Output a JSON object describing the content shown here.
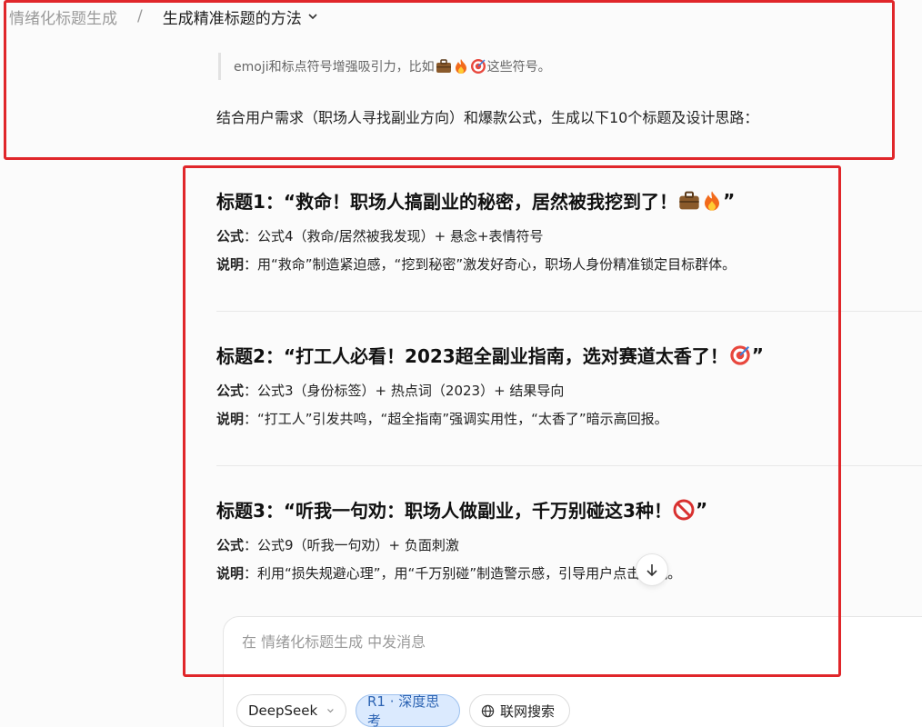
{
  "breadcrumb": {
    "root": "情绪化标题生成",
    "separator": "/",
    "current": "生成精准标题的方法"
  },
  "quote": {
    "text_before": "emoji和标点符号增强吸引力，比如",
    "emojis": [
      "briefcase-emoji",
      "fire-emoji",
      "target-emoji"
    ],
    "text_after": "这些符号。"
  },
  "intro": "结合用户需求（职场人寻找副业方向）和爆款公式，生成以下10个标题及设计思路：",
  "titles": [
    {
      "heading": "标题1：“救命！职场人搞副业的秘密，居然被我挖到了！",
      "emojis": [
        "briefcase-emoji",
        "fire-emoji"
      ],
      "heading_end": "”",
      "formula_label": "公式",
      "formula": "：公式4（救命/居然被我发现）+ 悬念+表情符号",
      "explain_label": "说明",
      "explain": "：用“救命”制造紧迫感，“挖到秘密”激发好奇心，职场人身份精准锁定目标群体。"
    },
    {
      "heading": "标题2：“打工人必看！2023超全副业指南，选对赛道太香了！",
      "emojis": [
        "target-emoji"
      ],
      "heading_end": "”",
      "formula_label": "公式",
      "formula": "：公式3（身份标签）+ 热点词（2023）+ 结果导向",
      "explain_label": "说明",
      "explain": "：“打工人”引发共鸣，“超全指南”强调实用性，“太香了”暗示高回报。"
    },
    {
      "heading": "标题3：“听我一句劝：职场人做副业，千万别碰这3种！",
      "emojis": [
        "no-entry-emoji"
      ],
      "heading_end": "”",
      "formula_label": "公式",
      "formula": "：公式9（听我一句劝）+ 负面刺激",
      "explain_label": "说明",
      "explain": "：利用“损失规避心理”，用“千万别碰”制造警示感，引导用户点击避坑。"
    }
  ],
  "composer": {
    "placeholder": "在 情绪化标题生成 中发消息"
  },
  "chips": {
    "model": "DeepSeek",
    "deep_think": "R1 · 深度思考",
    "web_search": "联网搜索"
  },
  "colors": {
    "highlight_box": "#e0262a",
    "chip_active_bg": "#dbeafe",
    "chip_active_text": "#2d64b3"
  }
}
